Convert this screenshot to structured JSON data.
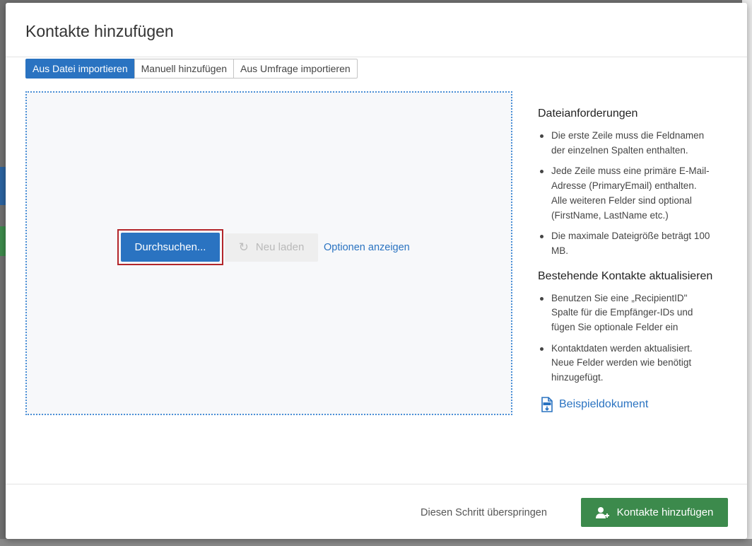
{
  "modal": {
    "title": "Kontakte hinzufügen"
  },
  "tabs": [
    {
      "label": "Aus Datei importieren",
      "active": true
    },
    {
      "label": "Manuell hinzufügen",
      "active": false
    },
    {
      "label": "Aus Umfrage importieren",
      "active": false
    }
  ],
  "dropzone": {
    "browse_label": "Durchsuchen...",
    "reload_label": "Neu laden",
    "options_label": "Optionen anzeigen"
  },
  "requirements": {
    "heading": "Dateianforderungen",
    "items": [
      "Die erste Zeile muss die Feldnamen der einzelnen Spalten enthalten.",
      "Jede Zeile muss eine primäre E-Mail-Adresse (PrimaryEmail) enthalten. Alle weiteren Felder sind optional (FirstName, LastName etc.)",
      "Die maximale Dateigröße beträgt 100 MB."
    ]
  },
  "update": {
    "heading": "Bestehende Kontakte aktualisieren",
    "items": [
      "Benutzen Sie eine „RecipientID\" Spalte für die Empfänger-IDs und fügen Sie optionale Felder ein",
      "Kontaktdaten werden aktualisiert. Neue Felder werden wie benötigt hinzugefügt."
    ]
  },
  "sample_link": "Beispieldokument",
  "footer": {
    "skip_label": "Diesen Schritt überspringen",
    "add_label": "Kontakte hinzufügen"
  },
  "colors": {
    "primary": "#2a73c1",
    "success": "#3c8a4c",
    "highlight": "#b3262a"
  },
  "icons": {
    "reload": "reload-icon",
    "document": "csv-document-icon",
    "add_user": "add-user-icon"
  }
}
